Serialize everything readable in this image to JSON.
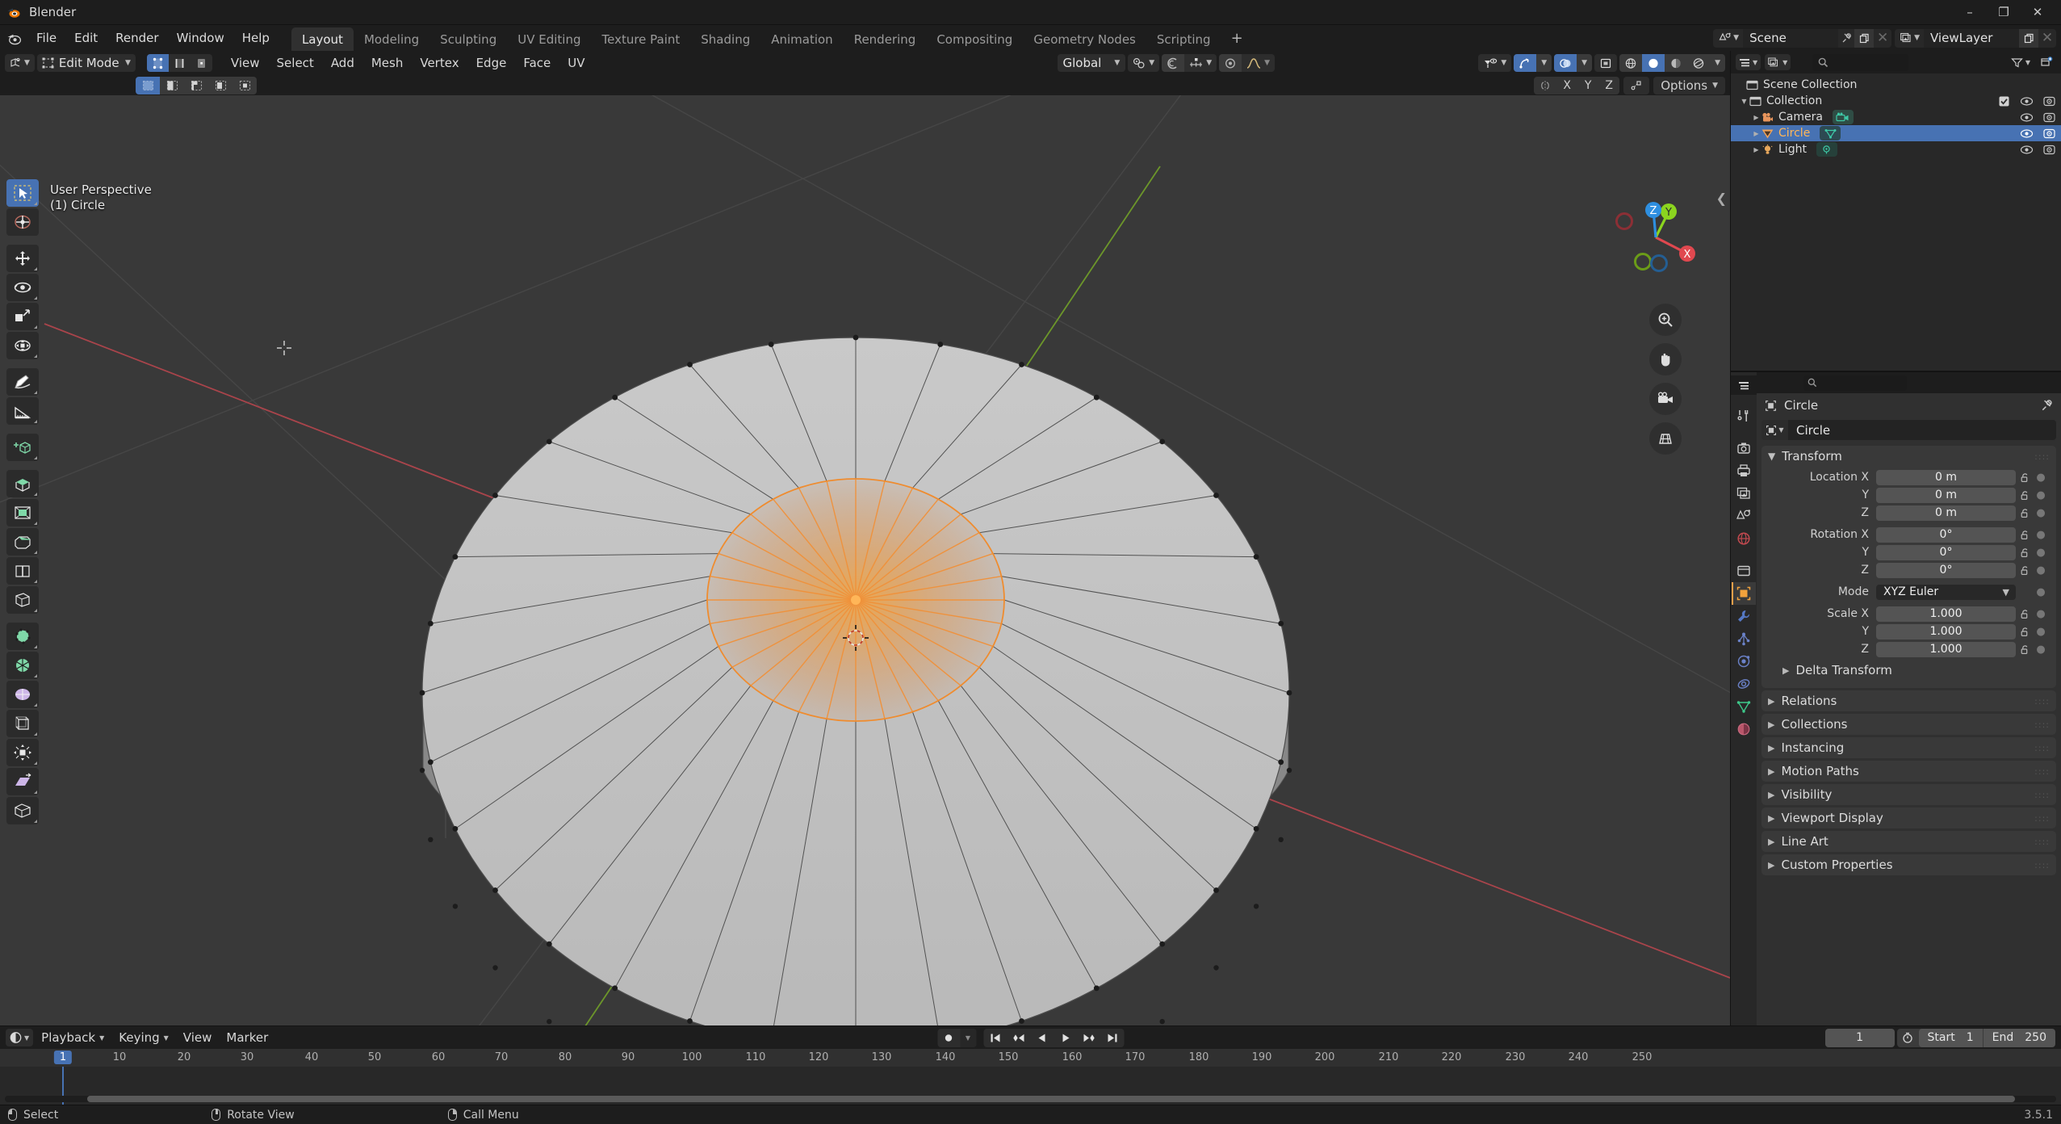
{
  "window": {
    "app_title": "Blender",
    "version": "3.5.1",
    "minimize": "–",
    "maximize": "❐",
    "close": "✕"
  },
  "topbar": {
    "menus": [
      "File",
      "Edit",
      "Render",
      "Window",
      "Help"
    ],
    "workspaces": [
      {
        "label": "Layout",
        "active": true
      },
      {
        "label": "Modeling",
        "active": false
      },
      {
        "label": "Sculpting",
        "active": false
      },
      {
        "label": "UV Editing",
        "active": false
      },
      {
        "label": "Texture Paint",
        "active": false
      },
      {
        "label": "Shading",
        "active": false
      },
      {
        "label": "Animation",
        "active": false
      },
      {
        "label": "Rendering",
        "active": false
      },
      {
        "label": "Compositing",
        "active": false
      },
      {
        "label": "Geometry Nodes",
        "active": false
      },
      {
        "label": "Scripting",
        "active": false
      }
    ],
    "add_workspace": "+",
    "scene_name": "Scene",
    "viewlayer_name": "ViewLayer"
  },
  "viewport_header": {
    "mode": "Edit Mode",
    "select_modes": [
      "vertex-select",
      "edge-select",
      "face-select"
    ],
    "active_select_mode": "vertex-select",
    "menus": [
      "View",
      "Select",
      "Add",
      "Mesh",
      "Vertex",
      "Edge",
      "Face",
      "UV"
    ],
    "transform_orientation": "Global",
    "snap_enabled": false,
    "proportional_editing": false,
    "xray": false,
    "shading_modes": [
      "wireframe",
      "solid",
      "material-preview",
      "rendered"
    ],
    "active_shading_mode": "solid",
    "mirror_axes": [
      "X",
      "Y",
      "Z"
    ],
    "options_label": "Options"
  },
  "viewport": {
    "perspective_label": "User Perspective",
    "object_label": "(1) Circle",
    "gizmo_axes": [
      {
        "label": "X",
        "color": "#e0484f"
      },
      {
        "label": "Y",
        "color": "#8bd41f"
      },
      {
        "label": "Z",
        "color": "#2e8fe0"
      }
    ],
    "nav_buttons": [
      "zoom-icon",
      "pan-hand-icon",
      "camera-view-icon",
      "toggle-perspective-icon"
    ],
    "tools": [
      {
        "name": "tweak-select-box-tool",
        "active": true
      },
      {
        "name": "cursor-tool",
        "active": false
      },
      {
        "name": "move-tool",
        "active": false
      },
      {
        "name": "rotate-tool",
        "active": false
      },
      {
        "name": "scale-tool",
        "active": false
      },
      {
        "name": "transform-tool",
        "active": false
      },
      {
        "name": "annotate-tool",
        "active": false
      },
      {
        "name": "measure-tool",
        "active": false
      },
      {
        "name": "add-cube-tool",
        "active": false
      },
      {
        "name": "extrude-region-tool",
        "active": false
      },
      {
        "name": "inset-faces-tool",
        "active": false
      },
      {
        "name": "bevel-tool",
        "active": false
      },
      {
        "name": "loop-cut-tool",
        "active": false
      },
      {
        "name": "knife-tool",
        "active": false
      },
      {
        "name": "poly-build-tool",
        "active": false
      },
      {
        "name": "spin-tool",
        "active": false
      },
      {
        "name": "smooth-tool",
        "active": false
      },
      {
        "name": "edge-slide-tool",
        "active": false
      },
      {
        "name": "shrink-fatten-tool",
        "active": false
      },
      {
        "name": "shear-tool",
        "active": false
      },
      {
        "name": "rip-region-tool",
        "active": false
      }
    ]
  },
  "outliner": {
    "search_placeholder": "",
    "filter_icon": "filter-icon",
    "new_collection_icon": "new-collection-icon",
    "rows": [
      {
        "name": "Scene Collection",
        "icon": "scene-collection-icon",
        "indent": 0,
        "expander": "",
        "selected": false,
        "checkbox": false,
        "eye": false,
        "camera": false
      },
      {
        "name": "Collection",
        "icon": "collection-icon",
        "indent": 1,
        "expander": "▼",
        "selected": false,
        "checkbox": true,
        "eye": true,
        "camera": true
      },
      {
        "name": "Camera",
        "icon": "camera-object-icon",
        "indent": 2,
        "expander": "▶",
        "selected": false,
        "checkbox": false,
        "eye": true,
        "camera": true,
        "datatype": "camera-data-icon",
        "datacolor": "#3ec9a7"
      },
      {
        "name": "Circle",
        "icon": "mesh-object-icon",
        "indent": 2,
        "expander": "▶",
        "selected": true,
        "checkbox": false,
        "eye": true,
        "camera": true,
        "datatype": "mesh-data-icon",
        "datacolor": "#3ec9a7"
      },
      {
        "name": "Light",
        "icon": "light-object-icon",
        "indent": 2,
        "expander": "▶",
        "selected": false,
        "checkbox": false,
        "eye": true,
        "camera": true,
        "datatype": "light-data-icon",
        "datacolor": "#3ec9a7"
      }
    ]
  },
  "properties": {
    "search_placeholder": "",
    "tabs": [
      {
        "name": "tool-tab",
        "icon": "tool-icon",
        "active": false
      },
      {
        "name": "render-tab",
        "icon": "render-camera-icon",
        "active": false
      },
      {
        "name": "output-tab",
        "icon": "printer-icon",
        "active": false
      },
      {
        "name": "view-layer-tab",
        "icon": "images-icon",
        "active": false
      },
      {
        "name": "scene-tab",
        "icon": "scene-cone-icon",
        "active": false
      },
      {
        "name": "world-tab",
        "icon": "world-globe-icon",
        "active": false
      },
      {
        "name": "collection-tab",
        "icon": "collection-box-icon",
        "active": false
      },
      {
        "name": "object-tab",
        "icon": "object-square-icon",
        "active": true
      },
      {
        "name": "modifier-tab",
        "icon": "wrench-icon",
        "active": false
      },
      {
        "name": "particles-tab",
        "icon": "particles-icon",
        "active": false
      },
      {
        "name": "physics-tab",
        "icon": "physics-orbit-icon",
        "active": false
      },
      {
        "name": "constraints-tab",
        "icon": "constraint-icon",
        "active": false
      },
      {
        "name": "data-tab",
        "icon": "mesh-data-triangle-icon",
        "active": false
      },
      {
        "name": "material-tab",
        "icon": "material-sphere-icon",
        "active": false
      }
    ],
    "breadcrumb": "Circle",
    "id_name": "Circle",
    "transform": {
      "title": "Transform",
      "rows": [
        {
          "label": "Location X",
          "value": "0 m",
          "lock": true
        },
        {
          "label": "Y",
          "value": "0 m",
          "lock": true
        },
        {
          "label": "Z",
          "value": "0 m",
          "lock": true
        },
        {
          "label": "Rotation X",
          "value": "0°",
          "lock": true,
          "gap": true
        },
        {
          "label": "Y",
          "value": "0°",
          "lock": true
        },
        {
          "label": "Z",
          "value": "0°",
          "lock": true
        },
        {
          "label": "Mode",
          "value": "XYZ Euler",
          "lock": false,
          "dropdown": true,
          "gap": true
        },
        {
          "label": "Scale X",
          "value": "1.000",
          "lock": true,
          "gap": true
        },
        {
          "label": "Y",
          "value": "1.000",
          "lock": true
        },
        {
          "label": "Z",
          "value": "1.000",
          "lock": true
        }
      ],
      "sub_panel": "Delta Transform"
    },
    "collapsed_panels": [
      "Relations",
      "Collections",
      "Instancing",
      "Motion Paths",
      "Visibility",
      "Viewport Display",
      "Line Art",
      "Custom Properties"
    ]
  },
  "timeline": {
    "menus": [
      "Playback",
      "Keying",
      "View",
      "Marker"
    ],
    "playback_buttons": [
      "jump-to-start",
      "jump-to-prev-keyframe",
      "play-reverse",
      "play",
      "jump-to-next-keyframe",
      "jump-to-end"
    ],
    "current_frame": "1",
    "start_label": "Start",
    "start_value": "1",
    "end_label": "End",
    "end_value": "250",
    "playhead_frame": "1",
    "ticks": [
      10,
      20,
      30,
      40,
      50,
      60,
      70,
      80,
      90,
      100,
      110,
      120,
      130,
      140,
      150,
      160,
      170,
      180,
      190,
      200,
      210,
      220,
      230,
      240,
      250
    ]
  },
  "statusbar": {
    "items": [
      {
        "mouse": "left",
        "label": "Select"
      },
      {
        "mouse": "middle",
        "label": "Rotate View"
      },
      {
        "mouse": "right",
        "label": "Call Menu"
      }
    ],
    "version": "3.5.1"
  },
  "colors": {
    "accent_blue": "#4772b3",
    "orange_selected": "#ffb658",
    "edit_orange": "#e87d0d",
    "bg_dark": "#1d1d1d",
    "bg_viewport": "#393939"
  }
}
